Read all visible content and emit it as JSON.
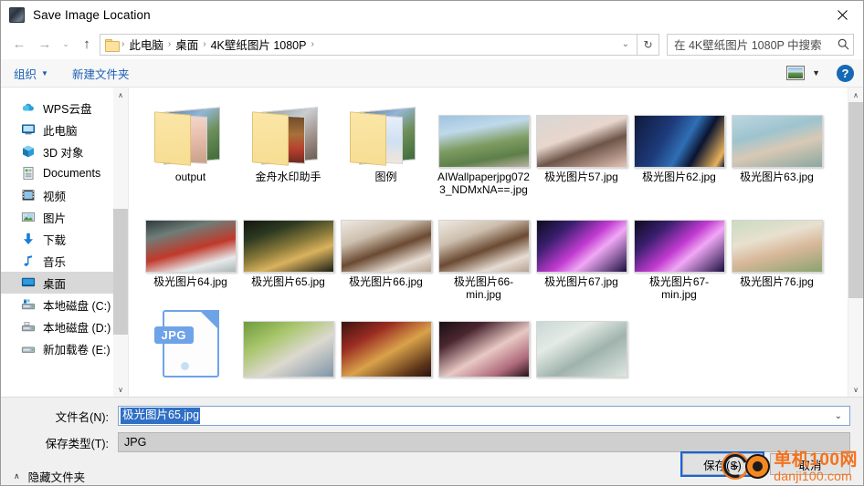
{
  "window": {
    "title": "Save Image Location",
    "app_icon": "app-icon",
    "close_label": "✕"
  },
  "nav": {
    "back": "←",
    "forward": "→",
    "recent_dropdown": "⌄",
    "up": "↑",
    "refresh": "↻",
    "breadcrumb": [
      "此电脑",
      "桌面",
      "4K壁纸图片 1080P"
    ],
    "breadcrumb_separator": "›",
    "address_caret": "⌄",
    "search_placeholder": "在 4K壁纸图片 1080P 中搜索",
    "search_icon": "search-icon"
  },
  "commandbar": {
    "organize": "组织",
    "organize_caret": "▼",
    "new_folder": "新建文件夹",
    "view_caret": "▼",
    "help": "?"
  },
  "sidebar": {
    "items": [
      {
        "label": "WPS云盘",
        "icon": "cloud-icon",
        "selected": false
      },
      {
        "label": "此电脑",
        "icon": "computer-icon",
        "selected": false
      },
      {
        "label": "3D 对象",
        "icon": "cube-icon",
        "selected": false
      },
      {
        "label": "Documents",
        "icon": "documents-icon",
        "selected": false
      },
      {
        "label": "视频",
        "icon": "video-icon",
        "selected": false
      },
      {
        "label": "图片",
        "icon": "pictures-icon",
        "selected": false
      },
      {
        "label": "下载",
        "icon": "downloads-icon",
        "selected": false
      },
      {
        "label": "音乐",
        "icon": "music-icon",
        "selected": false
      },
      {
        "label": "桌面",
        "icon": "desktop-icon",
        "selected": true
      },
      {
        "label": "本地磁盘 (C:)",
        "icon": "drive-system-icon",
        "selected": false
      },
      {
        "label": "本地磁盘 (D:)",
        "icon": "drive-icon",
        "selected": false
      },
      {
        "label": "新加载卷 (E:)",
        "icon": "drive-icon",
        "selected": false
      }
    ],
    "scroll_up": "∧",
    "scroll_down": "∨"
  },
  "files": {
    "scroll_up": "∧",
    "scroll_down": "∨",
    "items": [
      {
        "name": "output",
        "type": "folder",
        "back": "linear-gradient(150deg,#5b7fae 0%,#93b6d6 30%,#6e8f5a 60%,#3f6b3a 100%)",
        "inner": "linear-gradient(170deg,#f3d9cf 0%,#e8bfae 45%,#caa089 100%)"
      },
      {
        "name": "金舟水印助手",
        "type": "folder",
        "back": "linear-gradient(150deg,#8b9aa8 0%,#c9cdd2 35%,#9d8e86 70%,#6b5e55 100%)",
        "inner": "linear-gradient(175deg,#6a4a2c 0%,#a8703a 40%,#b8402f 70%,#6d2a20 100%)"
      },
      {
        "name": "图例",
        "type": "folder",
        "back": "linear-gradient(150deg,#5b7fae 0%,#93b6d6 30%,#6e8f5a 60%,#3f6b3a 100%)",
        "inner": "linear-gradient(175deg,#e8f0fa 0%,#cfe0f2 55%,#f2e6d8 100%)"
      },
      {
        "name": "AIWallpaperjpg0723_NDMxNA==.jpg",
        "type": "photo",
        "thumb": "linear-gradient(170deg,#9fc3e0 0%,#bfd9ea 28%,#7e9c62 55%,#5d7f49 78%,#b9b1a3 100%)"
      },
      {
        "name": "极光图片57.jpg",
        "type": "photo",
        "thumb": "linear-gradient(160deg,#d8d6d4 0%,#e8d6cc 40%,#6e5449 62%,#e3c3b4 100%)"
      },
      {
        "name": "极光图片62.jpg",
        "type": "photo",
        "thumb": "linear-gradient(120deg,#101a3a 0%,#1d3a7a 35%,#2f6fb5 55%,#0b1430 70%,#e8b25a 92%,#101a3a 100%)"
      },
      {
        "name": "极光图片63.jpg",
        "type": "photo",
        "thumb": "linear-gradient(165deg,#bcd6df 0%,#9ec4cf 35%,#d8c9b5 60%,#8aa7a0 100%)"
      },
      {
        "name": "极光图片64.jpg",
        "type": "photo",
        "thumb": "linear-gradient(165deg,#2e3a3c 0%,#6f7d78 25%,#c0392b 55%,#e6e9ea 80%,#aab6b4 100%)"
      },
      {
        "name": "极光图片65.jpg",
        "type": "photo",
        "thumb": "linear-gradient(160deg,#13170f 0%,#2d3a20 25%,#8a7a3a 50%,#d9b25e 68%,#1a1d14 100%)"
      },
      {
        "name": "极光图片66.jpg",
        "type": "photo",
        "thumb": "linear-gradient(160deg,#efe9e2 0%,#cdbfae 30%,#6b4a32 55%,#e6dcd2 80%,#b7a292 100%)"
      },
      {
        "name": "极光图片66-min.jpg",
        "type": "photo",
        "thumb": "linear-gradient(160deg,#efe9e2 0%,#cdbfae 30%,#6b4a32 55%,#e6dcd2 80%,#b7a292 100%)"
      },
      {
        "name": "极光图片67.jpg",
        "type": "photo",
        "thumb": "linear-gradient(140deg,#0d0b1e 0%,#3a1f6e 25%,#c13ad0 50%,#f0a8f5 65%,#1b1040 100%)"
      },
      {
        "name": "极光图片67-min.jpg",
        "type": "photo",
        "thumb": "linear-gradient(140deg,#0d0b1e 0%,#3a1f6e 25%,#c13ad0 50%,#f0a8f5 65%,#1b1040 100%)"
      },
      {
        "name": "极光图片76.jpg",
        "type": "photo",
        "thumb": "linear-gradient(165deg,#c9dcc2 0%,#e8e0cf 35%,#d8b89a 60%,#8aa36e 100%)"
      },
      {
        "name": "",
        "type": "jpgdoc",
        "tag": "JPG"
      },
      {
        "name": "",
        "type": "photo_partial",
        "thumb": "linear-gradient(150deg,#6f9a3e 0%,#a8c56a 30%,#dcd9cf 60%,#7f94a8 100%)"
      },
      {
        "name": "",
        "type": "photo_partial",
        "thumb": "linear-gradient(150deg,#3a1410 0%,#9b2c22 28%,#d9a24a 55%,#5c3418 85%,#2a1410 100%)"
      },
      {
        "name": "",
        "type": "photo_partial",
        "thumb": "linear-gradient(150deg,#1a1014 0%,#4a2630 25%,#e8c9c4 55%,#b06a7c 80%,#231418 100%)"
      },
      {
        "name": "",
        "type": "photo_partial",
        "thumb": "linear-gradient(150deg,#c9d8d4 0%,#e4eae6 30%,#9fb3ac 60%,#dfe6e2 100%)"
      }
    ]
  },
  "form": {
    "filename_label": "文件名(N):",
    "filename_value": "极光图片65.jpg",
    "filename_caret": "⌄",
    "savetype_label": "保存类型(T):",
    "savetype_value": "JPG",
    "hide_folders": "隐藏文件夹",
    "hide_folders_chevron": "∧",
    "save_button": "保存(S)",
    "cancel_button": "取消"
  },
  "watermark": {
    "cn": "单机100网",
    "en": "danji100.com",
    "plus": "+",
    "color": "#f4721b"
  }
}
